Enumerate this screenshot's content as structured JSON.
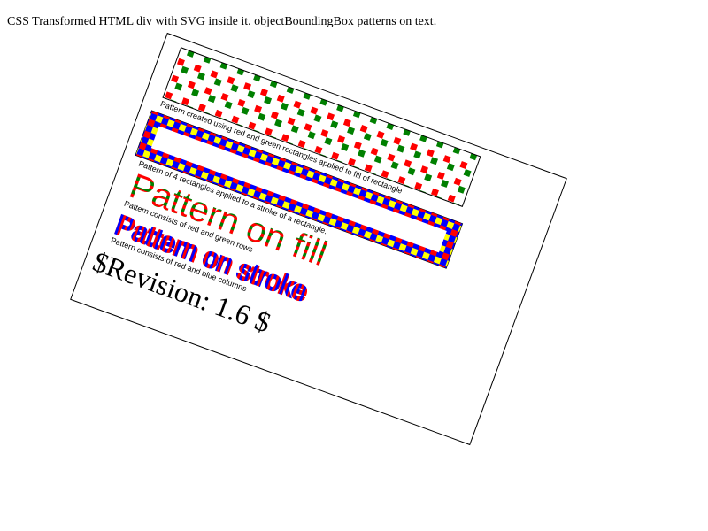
{
  "page": {
    "title": "CSS Transformed HTML div with SVG inside it. objectBoundingBox patterns on text."
  },
  "colors": {
    "red": "#ff0000",
    "green": "#008000",
    "blue": "#0000ff",
    "yellow": "#ffff00",
    "black": "#000000",
    "white": "#ffffff"
  },
  "svg": {
    "caption_fill_rect": "Pattern created using red and green rectangles applied to fill of rectangle",
    "caption_stroke_rect": "Pattern of 4 rectangles applied to a stroke of a rectangle.",
    "text_fill": "Pattern on fill",
    "caption_text_fill": "Pattern consists of red and green rows",
    "text_stroke": "Pattern on stroke",
    "caption_text_stroke": "Pattern consists of red and blue columns",
    "revision": "$Revision: 1.6 $"
  }
}
